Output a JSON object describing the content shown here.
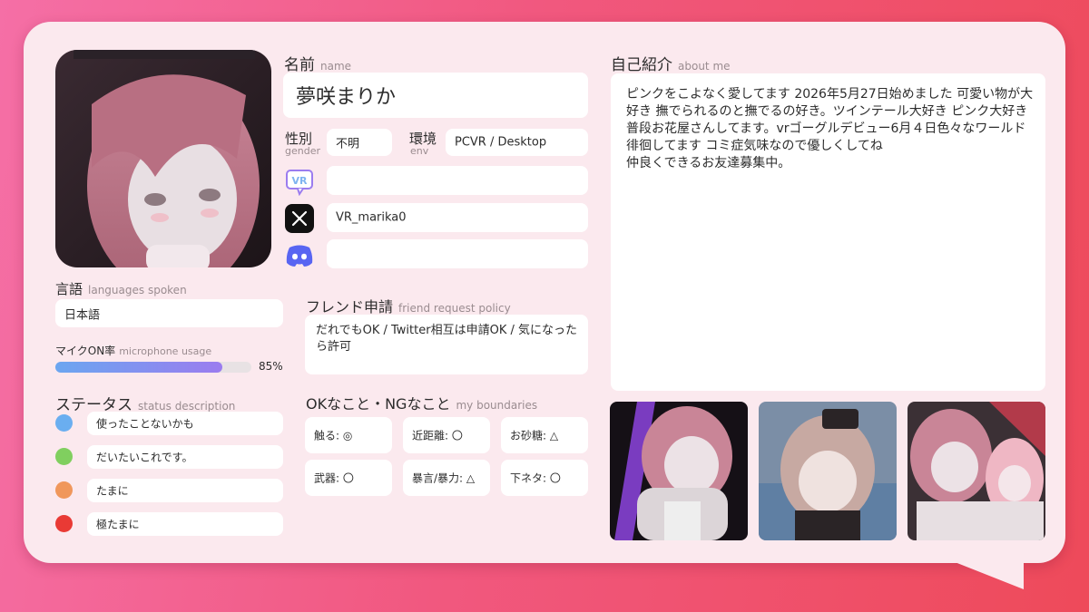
{
  "name": {
    "label": "名前",
    "sub": "name",
    "value": "夢咲まりか"
  },
  "gender": {
    "label": "性別",
    "sub": "gender",
    "value": "不明"
  },
  "env": {
    "label": "環境",
    "sub": "env",
    "value": "PCVR / Desktop"
  },
  "socials": {
    "vrchat": {
      "icon": "vrchat-icon",
      "value": ""
    },
    "x": {
      "icon": "x-icon",
      "value": "VR_marika0"
    },
    "discord": {
      "icon": "discord-icon",
      "value": ""
    }
  },
  "about": {
    "label": "自己紹介",
    "sub": "about me",
    "text": "ピンクをこよなく愛してます 2026年5月27日始めました 可愛い物が大好き 撫でられるのと撫でるの好き。ツインテール大好き ピンク大好き 普段お花屋さんしてます。vrゴーグルデビュー6月４日色々なワールド徘徊してます コミ症気味なので優しくしてね\n仲良くできるお友達募集中。"
  },
  "languages": {
    "label": "言語",
    "sub": "languages spoken",
    "value": "日本語"
  },
  "mic": {
    "label": "マイクON率",
    "sub": "microphone usage",
    "percent": 85,
    "percent_text": "85%"
  },
  "friend": {
    "label": "フレンド申請",
    "sub": "friend request policy",
    "value": "だれでもOK / Twitter相互は申請OK / 気になったら許可"
  },
  "status": {
    "label": "ステータス",
    "sub": "status description",
    "items": [
      {
        "color": "#6aaef0",
        "text": "使ったことないかも"
      },
      {
        "color": "#80cf5f",
        "text": "だいたいこれです。"
      },
      {
        "color": "#f0975b",
        "text": "たまに"
      },
      {
        "color": "#e93a35",
        "text": "極たまに"
      }
    ]
  },
  "boundaries": {
    "label": "OKなこと・NGなこと",
    "sub": "my boundaries",
    "items": [
      "触る: ◎",
      "近距離: 〇",
      "お砂糖: △",
      "武器: 〇",
      "暴言/暴力: △",
      "下ネタ: 〇"
    ]
  },
  "colors": {
    "background_left": "#f56fa6",
    "background_right": "#ee4a5a",
    "card": "#fbe9ee"
  }
}
